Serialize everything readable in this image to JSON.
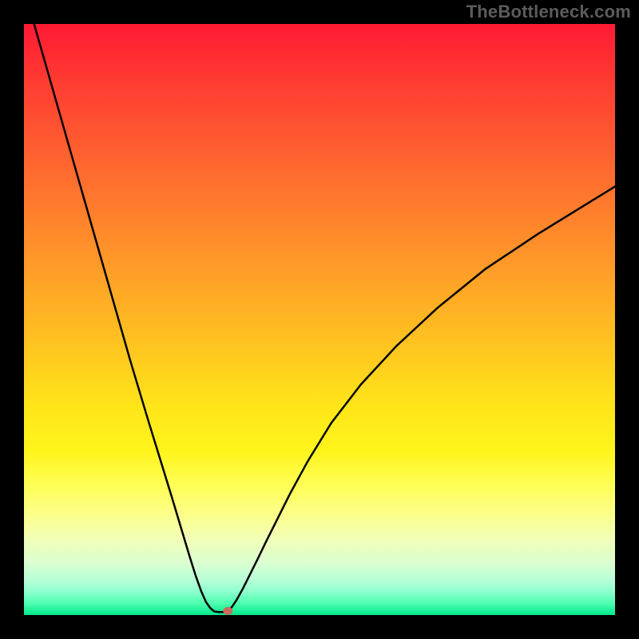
{
  "watermark": "TheBottleneck.com",
  "chart_data": {
    "type": "line",
    "title": "",
    "xlabel": "",
    "ylabel": "",
    "xlim": [
      0,
      100
    ],
    "ylim": [
      0,
      100
    ],
    "series": [
      {
        "name": "left-branch",
        "x": [
          0,
          4,
          8,
          12,
          16,
          18,
          21,
          23,
          25,
          26.5,
          28,
          29,
          30,
          30.8,
          31.5,
          32.2
        ],
        "values": [
          106,
          92,
          78,
          64,
          50,
          43,
          33,
          26.5,
          20,
          15,
          10,
          6.8,
          4,
          2.2,
          1.2,
          0.6
        ]
      },
      {
        "name": "flat-min",
        "x": [
          32.2,
          33.0,
          33.8,
          34.5
        ],
        "values": [
          0.6,
          0.5,
          0.5,
          0.6
        ]
      },
      {
        "name": "right-branch",
        "x": [
          34.5,
          35.2,
          36,
          37,
          38,
          39.5,
          41,
          43,
          45,
          48,
          52,
          57,
          63,
          70,
          78,
          87,
          100
        ],
        "values": [
          0.6,
          1.4,
          2.6,
          4.4,
          6.4,
          9.4,
          12.5,
          16.5,
          20.5,
          26,
          32.5,
          39,
          45.5,
          52,
          58.5,
          64.5,
          72.5
        ]
      }
    ],
    "marker": {
      "x": 34.5,
      "y": 0.7,
      "color": "#cb6a5c"
    },
    "gradient_colors": {
      "top": "#ff1a33",
      "mid": "#ffe619",
      "bottom": "#00e98a"
    }
  }
}
